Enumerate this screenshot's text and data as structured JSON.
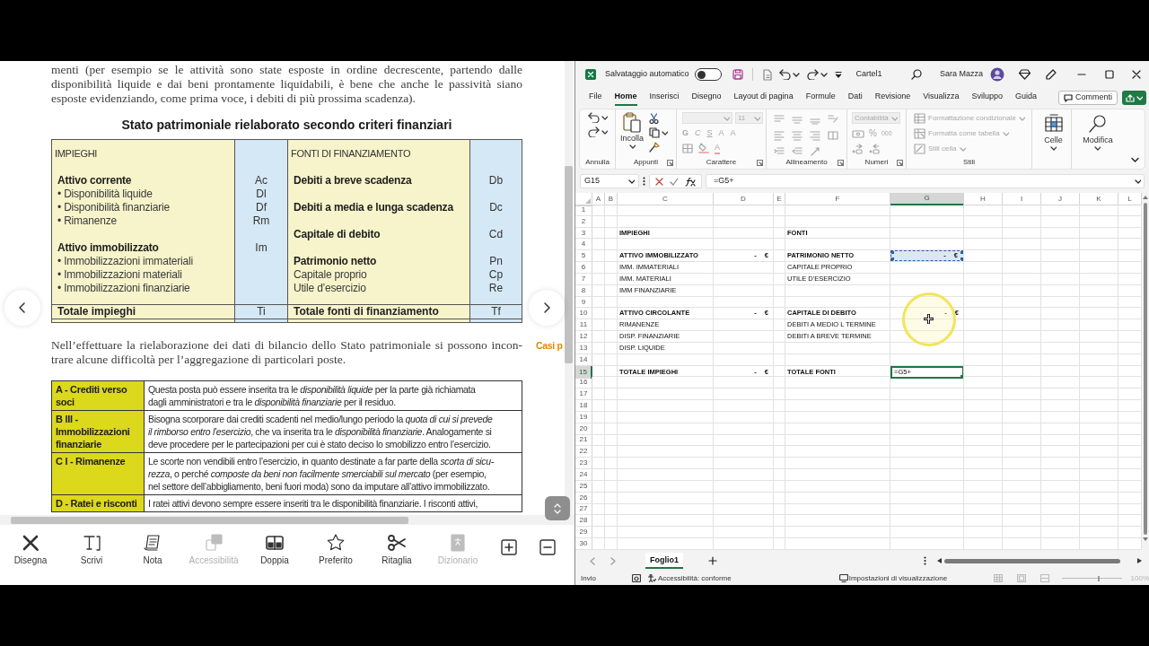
{
  "document": {
    "intro_lines": [
      "menti (per esempio se le attività sono state esposte in ordine decrescente, partendo dalle",
      "disponibilità liquide e dai beni prontamente liquidabili, è bene che anche le passività siano",
      "esposte evidenziando, come prima voce, i debiti di più prossima scadenza)."
    ],
    "table_title": "Stato patrimoniale rielaborato secondo criteri finanziari",
    "balance": [
      {
        "header": "IMPIEGHI",
        "items": [
          {
            "kind": "heading",
            "label": "Attivo corrente",
            "code": "Ac"
          },
          {
            "kind": "item",
            "label": "• Disponibilità liquide",
            "code": "Dl"
          },
          {
            "kind": "item",
            "label": "• Disponibilità finanziarie",
            "code": "Df"
          },
          {
            "kind": "item",
            "label": "• Rimanenze",
            "code": "Rm"
          },
          {
            "kind": "heading",
            "label": "Attivo immobilizzato",
            "code": "Im"
          },
          {
            "kind": "item",
            "label": "• Immobilizzazioni immateriali"
          },
          {
            "kind": "item",
            "label": "• Immobilizzazioni materiali"
          },
          {
            "kind": "item",
            "label": "• Immobilizzazioni finanziarie"
          }
        ],
        "total": {
          "label": "Totale impieghi",
          "code": "Ti"
        }
      },
      {
        "header": "FONTI DI FINANZIAMENTO",
        "items": [
          {
            "kind": "heading",
            "label": "Debiti a breve scadenza",
            "code": "Db"
          },
          {
            "kind": "heading",
            "label": "Debiti a media e lunga scadenza",
            "code": "Dc"
          },
          {
            "kind": "heading",
            "label": "Capitale di debito",
            "code": "Cd"
          },
          {
            "kind": "heading",
            "label": "Patrimonio netto",
            "code": "Pn"
          },
          {
            "kind": "item",
            "label": "Capitale proprio",
            "code": "Cp"
          },
          {
            "kind": "item",
            "label": "Utile d’esercizio",
            "code": "Re"
          }
        ],
        "total": {
          "label": "Totale fonti di finanziamento",
          "code": "Tf"
        }
      }
    ],
    "para_lines": [
      "Nell’effettuare la rielaborazione dei dati di bilancio dello Stato patrimoniale si possono incon-",
      "trare alcune difficoltà per l’aggregazione di particolari poste."
    ],
    "side_link": "Casi p",
    "notes": [
      {
        "head": [
          "A - Crediti verso",
          "soci"
        ],
        "body": [
          "Questa posta può essere inserita tra le *disponibilità liquide* per la parte già richiamata",
          "dagli amministratori e tra le *disponibilità finanziarie* per il residuo."
        ]
      },
      {
        "head": [
          "B III -",
          "Immobilizzazioni",
          "finanziarie"
        ],
        "body": [
          "Bisogna scorporare dai crediti scadenti nel medio/lungo periodo la *quota di cui si prevede*",
          "*il rimborso entro l’esercizio*, che va inserita tra le *disponibilità finanziarie*. Analogamente si",
          "deve procedere per le partecipazioni per cui è stato deciso lo smobilizzo entro l’esercizio."
        ]
      },
      {
        "head": [
          "C I - Rimanenze"
        ],
        "body": [
          "Le scorte non vendibili entro l’esercizio, in quanto destinate a far parte della *scorta di sicu-*",
          "*rezza*, o perché *composte da beni non facilmente smerciabili sul mercato* (per esempio,",
          "nel settore dell’abbigliamento, beni fuori moda) sono da imputare all’attivo immobilizzato."
        ]
      },
      {
        "head": [
          "D - Ratei e risconti"
        ],
        "body": [
          "I ratei attivi devono sempre essere inseriti tra le disponibilità finanziarie. I risconti attivi,"
        ]
      }
    ]
  },
  "toolbar": [
    {
      "label": "Disegna",
      "disabled": false
    },
    {
      "label": "Scrivi",
      "disabled": false
    },
    {
      "label": "Nota",
      "disabled": false
    },
    {
      "label": "Accessibilità",
      "disabled": true
    },
    {
      "label": "Doppia",
      "disabled": false
    },
    {
      "label": "Preferito",
      "disabled": false
    },
    {
      "label": "Ritaglia",
      "disabled": false
    },
    {
      "label": "Dizionario",
      "disabled": true
    }
  ],
  "excel": {
    "autosave_label": "Salvataggio automatico",
    "autosave_on": false,
    "file_name": "Cartel1",
    "user": "Sara Mazza",
    "menu": [
      {
        "label": "File",
        "selected": false
      },
      {
        "label": "Home",
        "selected": true
      },
      {
        "label": "Inserisci",
        "selected": false
      },
      {
        "label": "Disegno",
        "selected": false
      },
      {
        "label": "Layout di pagina",
        "selected": false
      },
      {
        "label": "Formule",
        "selected": false
      },
      {
        "label": "Dati",
        "selected": false
      },
      {
        "label": "Revisione",
        "selected": false
      },
      {
        "label": "Visualizza",
        "selected": false
      },
      {
        "label": "Sviluppo",
        "selected": false
      },
      {
        "label": "Guida",
        "selected": false
      }
    ],
    "comments_button": "Commenti",
    "ribbon": {
      "groups": [
        {
          "label": "Annulla",
          "disabled": false
        },
        {
          "label": "Appunti",
          "disabled": false,
          "paste": "Incolla"
        },
        {
          "label": "Carattere",
          "disabled": true,
          "font_size": "11",
          "buttons": [
            "G",
            "C",
            "S",
            "A",
            "A",
            "A"
          ]
        },
        {
          "label": "Allineamento",
          "disabled": true
        },
        {
          "label": "Numeri",
          "disabled": true,
          "format": "Contabilità",
          "percent": "%",
          "thousands": "000"
        },
        {
          "label": "Stili",
          "disabled": true,
          "items": [
            "Formattazione condizionale",
            "Formatta come tabella",
            "Stili cella"
          ]
        }
      ],
      "cells_button": "Celle",
      "edit_button": "Modifica"
    },
    "name_box": "G15",
    "formula": "=G5+",
    "columns": [
      {
        "label": "A",
        "selected": false
      },
      {
        "label": "B",
        "selected": false
      },
      {
        "label": "C",
        "selected": false
      },
      {
        "label": "D",
        "selected": false
      },
      {
        "label": "E",
        "selected": false
      },
      {
        "label": "F",
        "selected": false
      },
      {
        "label": "G",
        "selected": true
      },
      {
        "label": "H",
        "selected": false
      },
      {
        "label": "I",
        "selected": false
      },
      {
        "label": "J",
        "selected": false
      },
      {
        "label": "K",
        "selected": false
      },
      {
        "label": "L",
        "selected": false
      }
    ],
    "rows": [
      {
        "label": "1",
        "selected": false
      },
      {
        "label": "2",
        "selected": false
      },
      {
        "label": "3",
        "selected": false,
        "cells": {
          "C": {
            "kind": "label",
            "bold": true,
            "text": "IMPIEGHI"
          },
          "F": {
            "kind": "label",
            "bold": true,
            "text": "FONTI"
          }
        }
      },
      {
        "label": "4",
        "selected": false
      },
      {
        "label": "5",
        "selected": false,
        "cells": {
          "C": {
            "kind": "label",
            "bold": true,
            "text": "ATTIVO IMMOBILIZZATO"
          },
          "D": {
            "kind": "amount",
            "bold": true,
            "text": "-",
            "currency": "€"
          },
          "F": {
            "kind": "label",
            "bold": true,
            "text": "PATRIMONIO NETTO"
          },
          "G": {
            "kind": "copy_source",
            "bold": true,
            "text": "-",
            "currency": "€"
          }
        }
      },
      {
        "label": "6",
        "selected": false,
        "cells": {
          "C": {
            "kind": "label",
            "bold": false,
            "text": "IMM. IMMATERIALI"
          },
          "F": {
            "kind": "label",
            "bold": false,
            "text": "CAPITALE PROPRIO"
          }
        }
      },
      {
        "label": "7",
        "selected": false,
        "cells": {
          "C": {
            "kind": "label",
            "bold": false,
            "text": "IMM. MATERIALI"
          },
          "F": {
            "kind": "label",
            "bold": false,
            "text": "UTILE D'ESERCIZIO"
          }
        }
      },
      {
        "label": "8",
        "selected": false,
        "cells": {
          "C": {
            "kind": "label",
            "bold": false,
            "text": "IMM FINANZIARIE"
          }
        }
      },
      {
        "label": "9",
        "selected": false
      },
      {
        "label": "10",
        "selected": false,
        "cells": {
          "C": {
            "kind": "label",
            "bold": true,
            "text": "ATTIVO CIRCOLANTE"
          },
          "D": {
            "kind": "amount",
            "bold": true,
            "text": "-",
            "currency": "€"
          },
          "F": {
            "kind": "label",
            "bold": true,
            "text": "CAPITALE DI DEBITO"
          },
          "G": {
            "kind": "amount",
            "bold": true,
            "text": "-",
            "currency": "€"
          }
        }
      },
      {
        "label": "11",
        "selected": false,
        "cells": {
          "C": {
            "kind": "label",
            "bold": false,
            "text": "RIMANENZE"
          },
          "F": {
            "kind": "label",
            "bold": false,
            "text": "DEBITI A MEDIO L TERMINE"
          }
        }
      },
      {
        "label": "12",
        "selected": false,
        "cells": {
          "C": {
            "kind": "label",
            "bold": false,
            "text": "DISP. FINANZIARIE"
          },
          "F": {
            "kind": "label",
            "bold": false,
            "text": "DEBITI A BREVE TERMINE"
          }
        }
      },
      {
        "label": "13",
        "selected": false,
        "cells": {
          "C": {
            "kind": "label",
            "bold": false,
            "text": "DISP. LIQUIDE"
          }
        }
      },
      {
        "label": "14",
        "selected": false
      },
      {
        "label": "15",
        "selected": true,
        "cells": {
          "C": {
            "kind": "label",
            "bold": true,
            "text": "TOTALE IMPIEGHI"
          },
          "D": {
            "kind": "amount",
            "bold": true,
            "text": "-",
            "currency": "€"
          },
          "F": {
            "kind": "label",
            "bold": true,
            "text": "TOTALE FONTI"
          },
          "G": {
            "kind": "input",
            "bold": false,
            "text": "=G5+"
          }
        }
      },
      {
        "label": "16",
        "selected": false
      },
      {
        "label": "17",
        "selected": false
      },
      {
        "label": "18",
        "selected": false
      },
      {
        "label": "19",
        "selected": false
      },
      {
        "label": "20",
        "selected": false
      },
      {
        "label": "21",
        "selected": false
      },
      {
        "label": "22",
        "selected": false
      },
      {
        "label": "23",
        "selected": false
      },
      {
        "label": "24",
        "selected": false
      },
      {
        "label": "25",
        "selected": false
      },
      {
        "label": "26",
        "selected": false
      },
      {
        "label": "27",
        "selected": false
      },
      {
        "label": "28",
        "selected": false
      },
      {
        "label": "29",
        "selected": false
      },
      {
        "label": "30",
        "selected": false
      }
    ],
    "sheet_tabs": [
      {
        "label": "Foglio1",
        "selected": true
      }
    ],
    "status": {
      "mode": "Invio",
      "accessibility": "Accessibilità: conforme",
      "display_settings": "Impostazioni di visualizzazione",
      "zoom": "100%"
    }
  }
}
